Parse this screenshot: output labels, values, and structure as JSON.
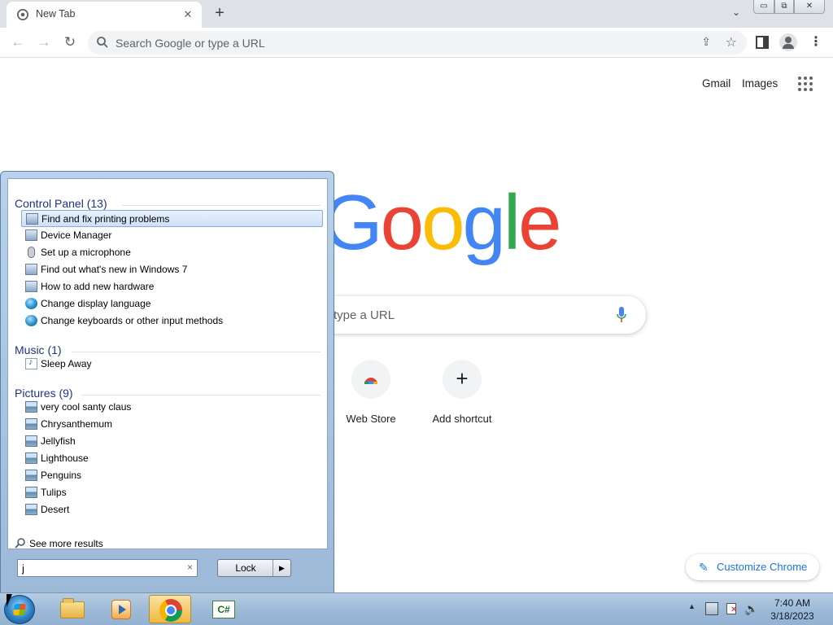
{
  "browser": {
    "tab_title": "New Tab",
    "tab_close_glyph": "✕",
    "new_tab_glyph": "+",
    "tab_search_glyph": "⌄",
    "window_buttons": {
      "minimize": "▭",
      "maximize": "⧉",
      "close": "✕"
    },
    "omnibox_placeholder": "Search Google or type a URL",
    "nav": {
      "back": "←",
      "forward": "→",
      "reload": "↻"
    },
    "share_glyph": "⇪",
    "star_glyph": "☆",
    "menu_glyph": "⋮"
  },
  "ntp": {
    "top_links": {
      "gmail": "Gmail",
      "images": "Images"
    },
    "logo_letters": [
      "G",
      "o",
      "o",
      "g",
      "l",
      "e"
    ],
    "search_placeholder": "type a URL",
    "shortcuts": [
      {
        "label": "Web Store"
      },
      {
        "label": "Add shortcut",
        "glyph": "+"
      }
    ],
    "customize_label": "Customize Chrome",
    "customize_glyph": "✎"
  },
  "start_menu": {
    "groups": [
      {
        "title": "Control Panel (13)",
        "items": [
          {
            "label": "Find and fix printing problems",
            "icon": "control-panel-icon",
            "selected": true
          },
          {
            "label": "Device Manager",
            "icon": "control-panel-icon"
          },
          {
            "label": "Set up a microphone",
            "icon": "microphone-icon"
          },
          {
            "label": "Find out what's new in Windows 7",
            "icon": "control-panel-icon"
          },
          {
            "label": "How to add new hardware",
            "icon": "control-panel-icon"
          },
          {
            "label": "Change display language",
            "icon": "globe-icon"
          },
          {
            "label": "Change keyboards or other input methods",
            "icon": "globe-icon"
          }
        ]
      },
      {
        "title": "Music (1)",
        "items": [
          {
            "label": "Sleep Away",
            "icon": "music-file-icon"
          }
        ]
      },
      {
        "title": "Pictures (9)",
        "items": [
          {
            "label": "very cool santy claus",
            "icon": "picture-file-icon"
          },
          {
            "label": "Chrysanthemum",
            "icon": "picture-file-icon"
          },
          {
            "label": "Jellyfish",
            "icon": "picture-file-icon"
          },
          {
            "label": "Lighthouse",
            "icon": "picture-file-icon"
          },
          {
            "label": "Penguins",
            "icon": "picture-file-icon"
          },
          {
            "label": "Tulips",
            "icon": "picture-file-icon"
          },
          {
            "label": "Desert",
            "icon": "picture-file-icon"
          }
        ]
      }
    ],
    "see_more": "See more results",
    "search_value": "j",
    "search_clear_glyph": "×",
    "lock_label": "Lock",
    "lock_arrow_glyph": "▶"
  },
  "taskbar": {
    "apps": [
      "windows-explorer",
      "windows-media-player",
      "google-chrome",
      "csharp-editor"
    ],
    "csharp_label": "C#",
    "tray_up_glyph": "▲",
    "volume_glyph": "🔊",
    "clock_time": "7:40 AM",
    "clock_date": "3/18/2023"
  }
}
